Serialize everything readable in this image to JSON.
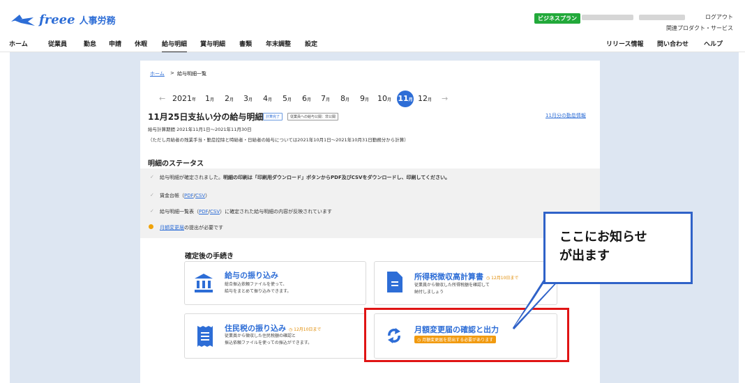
{
  "header": {
    "logo_text": "freee",
    "logo_sub": "人事労務",
    "plan_badge": "ビジネスプラン",
    "logout": "ログアウト",
    "related": "関連プロダクト・サービス"
  },
  "nav": {
    "items": [
      "ホーム",
      "従業員",
      "勤怠",
      "申請",
      "休暇",
      "給与明細",
      "賞与明細",
      "書類",
      "年末調整",
      "設定"
    ],
    "active_index": 5,
    "right_items": [
      "リリース情報",
      "問い合わせ",
      "ヘルプ"
    ]
  },
  "breadcrumb": {
    "home": "ホーム",
    "sep": ">",
    "current": "給与明細一覧"
  },
  "calendar": {
    "prev": "←",
    "next": "→",
    "year": "2021",
    "year_unit": "年",
    "month_unit": "月",
    "months": [
      "1",
      "2",
      "3",
      "4",
      "5",
      "6",
      "7",
      "8",
      "9",
      "10",
      "11",
      "12"
    ],
    "active_month": "11"
  },
  "payslip": {
    "title": "11月25日支払い分の給与明細",
    "tag_confirmed": "計算完了",
    "tag_public": "従業員への給与公開：非公開",
    "attendance_link": "11月分の勤怠情報",
    "period": "給与計算期間 2021年11月1日〜2021年11月30日",
    "note": "（ただし月給者の残業手当・勤怠控除と時給者・日給者の給与については2021年10月1日〜2021年10月31日勤務分から計算）"
  },
  "status": {
    "heading": "明細のステータス",
    "row1_text": "給与明細が確定されました。",
    "row1_bold": "明細の印刷は「印刷用ダウンロード」ボタンからPDF及びCSVをダウンロードし、印刷してください。",
    "row2_prefix": "賃金台帳（",
    "row3_prefix": "給与明細一覧表（",
    "row3_suffix": "）に確定された給与明細の内容が反映されています",
    "pdf": "PDF",
    "slash": "/",
    "csv": "CSV",
    "close_paren": "）",
    "row4_link": "月額変更届",
    "row4_suffix": "の提出が必要です"
  },
  "procedures": {
    "heading": "確定後の手続き",
    "cards": [
      {
        "title": "給与の振り込み",
        "deadline": "",
        "desc1": "総合振込依頼ファイルを使って、",
        "desc2": "給与をまとめて振り込みできます。"
      },
      {
        "title": "所得税徴収高計算書",
        "deadline": "12月10日まで",
        "desc1": "従業員から徴収した所得税額を確認して",
        "desc2": "納付しましょう"
      },
      {
        "title": "住民税の振り込み",
        "deadline": "12月10日まで",
        "desc1": "従業員から徴収した住民税額の確認と",
        "desc2": "振込依頼ファイルを使っての振込ができます。"
      },
      {
        "title": "月額変更届の確認と出力",
        "deadline": "",
        "badge": "月額変更届を提出する必要があります"
      }
    ]
  },
  "callout": {
    "line1": "ここにお知らせ",
    "line2": "が出ます"
  },
  "colors": {
    "brand_blue": "#2d6dd6",
    "callout_border": "#2f62c8",
    "highlight_red": "#e01414",
    "warning_orange": "#f19a0f",
    "plan_green": "#22a93a"
  }
}
